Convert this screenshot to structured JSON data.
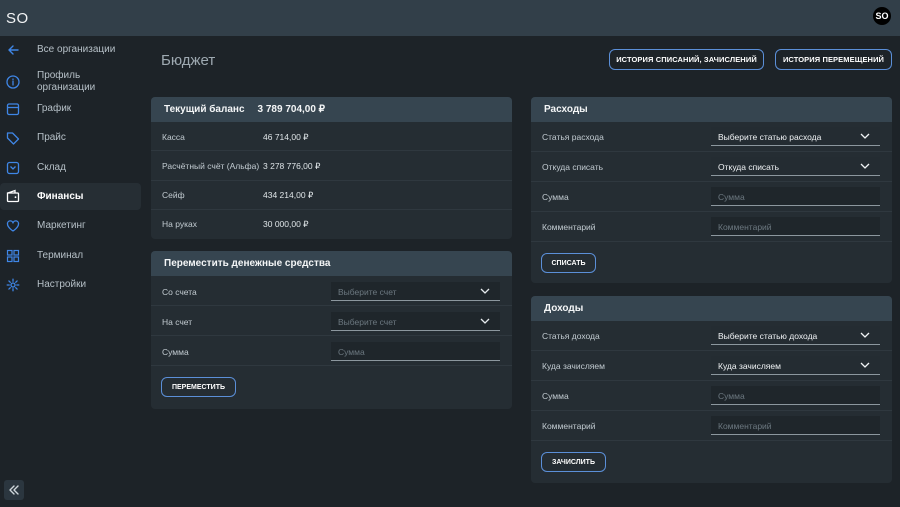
{
  "app": {
    "logo": "SO",
    "avatar": "SO"
  },
  "sidebar": {
    "items": [
      {
        "label": "Все организации",
        "icon": "arrow-left-icon"
      },
      {
        "label": "Профиль организации",
        "icon": "info-circle-icon"
      },
      {
        "label": "График",
        "icon": "calendar-icon"
      },
      {
        "label": "Прайс",
        "icon": "tag-icon"
      },
      {
        "label": "Склад",
        "icon": "box-icon"
      },
      {
        "label": "Финансы",
        "icon": "wallet-icon",
        "active": true
      },
      {
        "label": "Маркетинг",
        "icon": "heart-icon"
      },
      {
        "label": "Терминал",
        "icon": "grid-icon"
      },
      {
        "label": "Настройки",
        "icon": "gear-icon"
      }
    ],
    "collapse_icon": "double-chevron-left-icon"
  },
  "page": {
    "title": "Бюджет",
    "history_writeoffs_label": "ИСТОРИЯ СПИСАНИЙ, ЗАЧИСЛЕНИЙ",
    "history_moves_label": "ИСТОРИЯ ПЕРЕМЕЩЕНИЙ"
  },
  "balance": {
    "title": "Текущий баланс",
    "total": "3 789 704,00 ₽",
    "rows": [
      {
        "label": "Касса",
        "value": "46 714,00 ₽"
      },
      {
        "label": "Расчётный счёт (Альфа)",
        "value": "3 278 776,00 ₽"
      },
      {
        "label": "Сейф",
        "value": "434 214,00 ₽"
      },
      {
        "label": "На руках",
        "value": "30 000,00 ₽"
      }
    ]
  },
  "transfer": {
    "title": "Переместить денежные средства",
    "from_label": "Со счета",
    "from_placeholder": "Выберите счет",
    "to_label": "На счет",
    "to_placeholder": "Выберите счет",
    "amount_label": "Сумма",
    "amount_placeholder": "Сумма",
    "button": "ПЕРЕМЕСТИТЬ"
  },
  "expenses": {
    "title": "Расходы",
    "article_label": "Статья расхода",
    "article_value": "Выберите статью расхода",
    "source_label": "Откуда списать",
    "source_value": "Откуда списать",
    "amount_label": "Сумма",
    "amount_placeholder": "Сумма",
    "comment_label": "Комментарий",
    "comment_placeholder": "Комментарий",
    "button": "СПИСАТЬ"
  },
  "income": {
    "title": "Доходы",
    "article_label": "Статья дохода",
    "article_value": "Выберите статью дохода",
    "dest_label": "Куда зачисляем",
    "dest_value": "Куда зачисляем",
    "amount_label": "Сумма",
    "amount_placeholder": "Сумма",
    "comment_label": "Комментарий",
    "comment_placeholder": "Комментарий",
    "button": "ЗАЧИСЛИТЬ"
  },
  "colors": {
    "accent": "#5b8fd8",
    "sidebar_icon": "#3f86e6",
    "topbar": "#323f49",
    "background": "#1d2328"
  }
}
